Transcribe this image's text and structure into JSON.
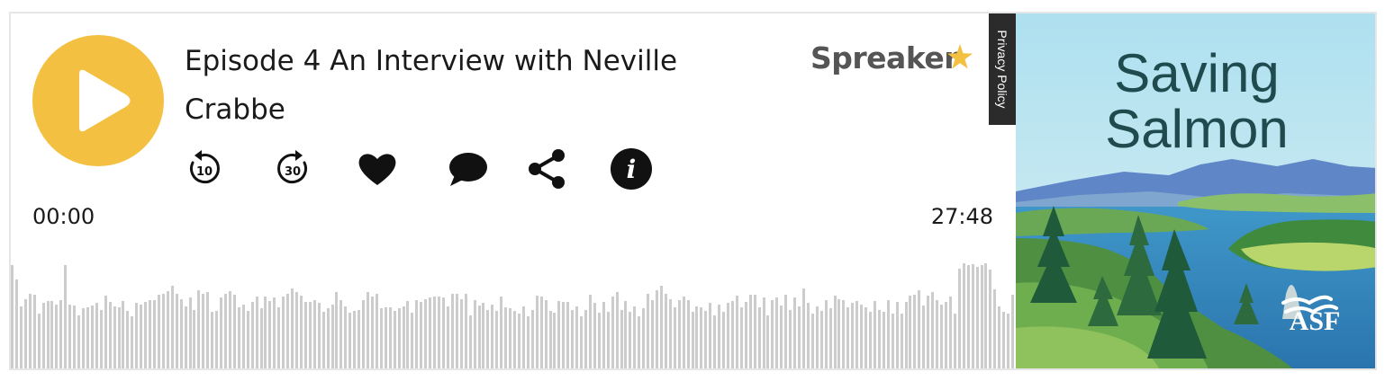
{
  "episode": {
    "title": "Episode 4 An Interview with Neville Crabbe",
    "current_time": "00:00",
    "duration": "27:48",
    "progress_fraction": 0
  },
  "brand": {
    "name": "Spreaker",
    "icon": "star-icon"
  },
  "privacy": {
    "label": "Privacy Policy"
  },
  "controls": {
    "rewind": {
      "icon": "rewind-10-icon",
      "label": "10"
    },
    "forward": {
      "icon": "forward-30-icon",
      "label": "30"
    },
    "like": {
      "icon": "heart-icon"
    },
    "comment": {
      "icon": "comment-icon"
    },
    "share": {
      "icon": "share-icon"
    },
    "info": {
      "icon": "info-icon",
      "label": "i"
    }
  },
  "cover": {
    "title_line1": "Saving",
    "title_line2": "Salmon",
    "logo_text": "ASF"
  },
  "waveform": {
    "levels": [
      0.98,
      0.85,
      0.6,
      0.67,
      0.72,
      0.71,
      0.53,
      0.63,
      0.65,
      0.65,
      0.62,
      0.66,
      0.98,
      0.62,
      0.61,
      0.52,
      0.58,
      0.59,
      0.61,
      0.63,
      0.57,
      0.7,
      0.64,
      0.6,
      0.59,
      0.65,
      0.56,
      0.51,
      0.63,
      0.62,
      0.64,
      0.66,
      0.66,
      0.71,
      0.72,
      0.74,
      0.79,
      0.72,
      0.67,
      0.6,
      0.68,
      0.57,
      0.75,
      0.72,
      0.73,
      0.55,
      0.56,
      0.68,
      0.72,
      0.74,
      0.71,
      0.59,
      0.62,
      0.56,
      0.64,
      0.69,
      0.58,
      0.69,
      0.65,
      0.68,
      0.59,
      0.69,
      0.72,
      0.77,
      0.73,
      0.7,
      0.64,
      0.64,
      0.66,
      0.63,
      0.55,
      0.58,
      0.62,
      0.73,
      0.66,
      0.6,
      0.54,
      0.56,
      0.57,
      0.66,
      0.73,
      0.69,
      0.72,
      0.58,
      0.59,
      0.59,
      0.56,
      0.58,
      0.6,
      0.65,
      0.54,
      0.66,
      0.64,
      0.67,
      0.68,
      0.69,
      0.69,
      0.68,
      0.6,
      0.72,
      0.72,
      0.67,
      0.72,
      0.52,
      0.66,
      0.61,
      0.63,
      0.57,
      0.62,
      0.56,
      0.69,
      0.59,
      0.58,
      0.56,
      0.53,
      0.6,
      0.51,
      0.57,
      0.7,
      0.69,
      0.66,
      0.56,
      0.54,
      0.65,
      0.64,
      0.64,
      0.57,
      0.6,
      0.51,
      0.57,
      0.71,
      0.63,
      0.54,
      0.64,
      0.55,
      0.69,
      0.73,
      0.57,
      0.65,
      0.55,
      0.6,
      0.51,
      0.58,
      0.72,
      0.66,
      0.75,
      0.79,
      0.72,
      0.67,
      0.59,
      0.66,
      0.69,
      0.66,
      0.55,
      0.6,
      0.59,
      0.56,
      0.63,
      0.52,
      0.62,
      0.55,
      0.63,
      0.65,
      0.7,
      0.59,
      0.64,
      0.71,
      0.71,
      0.59,
      0.68,
      0.52,
      0.66,
      0.68,
      0.61,
      0.71,
      0.57,
      0.68,
      0.6,
      0.77,
      0.63,
      0.53,
      0.6,
      0.56,
      0.66,
      0.58,
      0.7,
      0.67,
      0.66,
      0.59,
      0.63,
      0.65,
      0.62,
      0.59,
      0.55,
      0.65,
      0.57,
      0.55,
      0.66,
      0.53,
      0.64,
      0.53,
      0.64,
      0.7,
      0.71,
      0.75,
      0.61,
      0.7,
      0.73,
      0.66,
      0.62,
      0.64,
      0.69,
      0.53,
      0.95,
      1.0,
      0.98,
      0.99,
      0.97,
      0.98,
      1.0,
      0.94,
      0.76,
      0.6,
      0.55,
      0.53,
      0.71
    ]
  },
  "colors": {
    "accent": "#f4c042",
    "waveform": "#cccccc",
    "icon": "#111111",
    "brand_text": "#555555",
    "brand_star": "#f4c042",
    "privacy_bg": "#2b2b2b"
  }
}
